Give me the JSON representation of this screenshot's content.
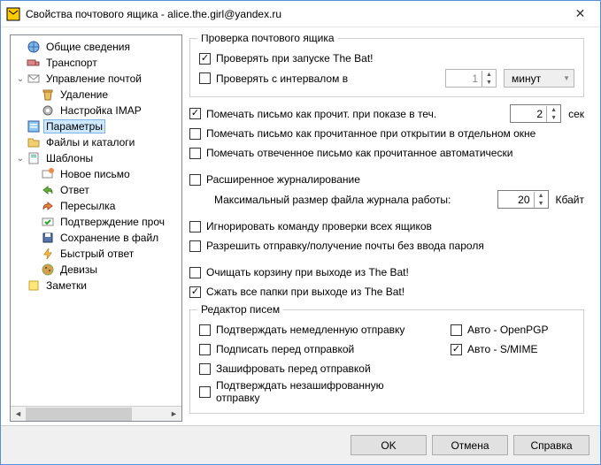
{
  "window": {
    "title": "Свойства почтового ящика - alice.the.girl@yandex.ru"
  },
  "tree": [
    {
      "label": "Общие сведения",
      "indent": 0,
      "exp": "",
      "icon": "globe"
    },
    {
      "label": "Транспорт",
      "indent": 0,
      "exp": "",
      "icon": "truck"
    },
    {
      "label": "Управление почтой",
      "indent": 0,
      "exp": "v",
      "icon": "mail"
    },
    {
      "label": "Удаление",
      "indent": 1,
      "exp": "",
      "icon": "trash"
    },
    {
      "label": "Настройка IMAP",
      "indent": 1,
      "exp": "",
      "icon": "gear"
    },
    {
      "label": "Параметры",
      "indent": 0,
      "exp": "",
      "icon": "options",
      "selected": true
    },
    {
      "label": "Файлы и каталоги",
      "indent": 0,
      "exp": "",
      "icon": "folder"
    },
    {
      "label": "Шаблоны",
      "indent": 0,
      "exp": "v",
      "icon": "templates"
    },
    {
      "label": "Новое письмо",
      "indent": 1,
      "exp": "",
      "icon": "newmail"
    },
    {
      "label": "Ответ",
      "indent": 1,
      "exp": "",
      "icon": "reply"
    },
    {
      "label": "Пересылка",
      "indent": 1,
      "exp": "",
      "icon": "forward"
    },
    {
      "label": "Подтверждение проч",
      "indent": 1,
      "exp": "",
      "icon": "confirm"
    },
    {
      "label": "Сохранение в файл",
      "indent": 1,
      "exp": "",
      "icon": "save"
    },
    {
      "label": "Быстрый ответ",
      "indent": 1,
      "exp": "",
      "icon": "quick"
    },
    {
      "label": "Девизы",
      "indent": 1,
      "exp": "",
      "icon": "cookies"
    },
    {
      "label": "Заметки",
      "indent": 0,
      "exp": "",
      "icon": "notes"
    }
  ],
  "group1": {
    "legend": "Проверка почтового ящика",
    "check_startup": {
      "label": "Проверять при запуске The Bat!",
      "checked": true
    },
    "check_interval": {
      "label": "Проверять с интервалом в",
      "checked": false,
      "value": "1",
      "unit": "минут"
    }
  },
  "mark_read": {
    "label": "Помечать письмо как прочит. при показе в теч.",
    "checked": true,
    "value": "2",
    "unit": "сек"
  },
  "mark_window": {
    "label": "Помечать письмо как прочитанное при открытии в отдельном окне",
    "checked": false
  },
  "mark_reply": {
    "label": "Помечать отвеченное письмо как прочитанное автоматически",
    "checked": false
  },
  "ext_log": {
    "label": "Расширенное журналирование",
    "checked": false
  },
  "log_size": {
    "label": "Максимальный размер файла журнала работы:",
    "value": "20",
    "unit": "Кбайт"
  },
  "ignore_all": {
    "label": "Игнорировать команду проверки всех ящиков",
    "checked": false
  },
  "allow_nopass": {
    "label": "Разрешить отправку/получение почты без ввода пароля",
    "checked": false
  },
  "empty_trash": {
    "label": "Очищать корзину при выходе из The Bat!",
    "checked": false
  },
  "compact": {
    "label": "Сжать все папки при выходе из The Bat!",
    "checked": true
  },
  "group2": {
    "legend": "Редактор писем",
    "confirm_send": {
      "label": "Подтверждать немедленную отправку",
      "checked": false
    },
    "sign": {
      "label": "Подписать перед отправкой",
      "checked": false
    },
    "encrypt": {
      "label": "Зашифровать перед отправкой",
      "checked": false
    },
    "confirm_unenc": {
      "label": "Подтверждать незашифрованную отправку",
      "checked": false
    },
    "auto_pgp": {
      "label": "Авто - OpenPGP",
      "checked": false
    },
    "auto_smime": {
      "label": "Авто - S/MIME",
      "checked": true
    }
  },
  "buttons": {
    "ok": "OK",
    "cancel": "Отмена",
    "help": "Справка"
  }
}
